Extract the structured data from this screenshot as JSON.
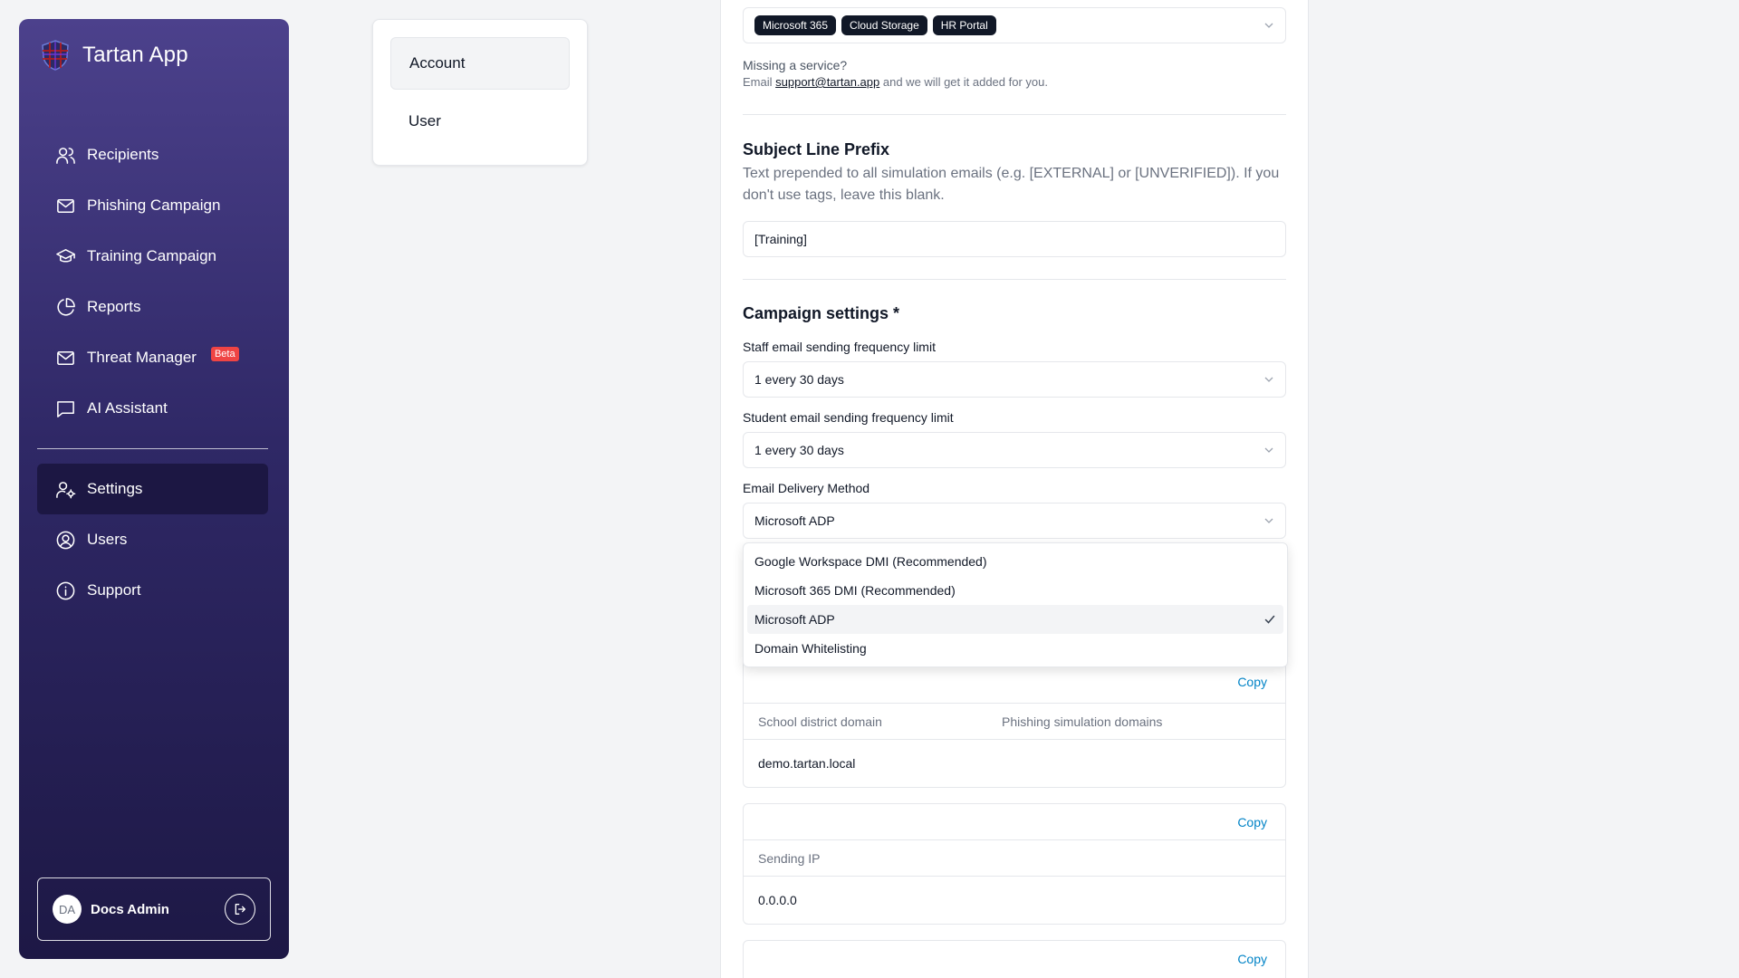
{
  "app": {
    "name": "Tartan App"
  },
  "sidebar": {
    "items": [
      {
        "label": "Recipients",
        "icon": "users-icon"
      },
      {
        "label": "Phishing Campaign",
        "icon": "mail-icon"
      },
      {
        "label": "Training Campaign",
        "icon": "graduation-cap-icon"
      },
      {
        "label": "Reports",
        "icon": "pie-chart-icon"
      },
      {
        "label": "Threat Manager",
        "icon": "mail-icon",
        "badge": "Beta"
      },
      {
        "label": "AI Assistant",
        "icon": "message-square-icon"
      }
    ],
    "secondary": [
      {
        "label": "Settings",
        "icon": "user-cog-icon",
        "active": true
      },
      {
        "label": "Users",
        "icon": "user-circle-icon"
      },
      {
        "label": "Support",
        "icon": "info-icon"
      }
    ],
    "user": {
      "initials": "DA",
      "name": "Docs Admin"
    }
  },
  "settings_menu": {
    "items": [
      "Account",
      "User"
    ]
  },
  "services": {
    "tags": [
      "Microsoft 365",
      "Cloud Storage",
      "HR Portal"
    ],
    "missing_title": "Missing a service?",
    "missing_prefix": "Email",
    "missing_email": "support@tartan.app",
    "missing_suffix": "and we will get it added for you."
  },
  "subject_prefix": {
    "title": "Subject Line Prefix",
    "description": "Text prepended to all simulation emails (e.g. [EXTERNAL] or [UNVERIFIED]). If you don't use tags, leave this blank.",
    "value": "[Training]"
  },
  "campaign": {
    "title": "Campaign settings *",
    "staff_label": "Staff email sending frequency limit",
    "staff_value": "1 every 30 days",
    "student_label": "Student email sending frequency limit",
    "student_value": "1 every 30 days",
    "delivery_label": "Email Delivery Method",
    "delivery_value": "Microsoft ADP",
    "delivery_options": [
      "Google Workspace DMI (Recommended)",
      "Microsoft 365 DMI (Recommended)",
      "Microsoft ADP",
      "Domain Whitelisting"
    ]
  },
  "cards": {
    "copy_label": "Copy",
    "domains": {
      "col1": "School district domain",
      "col2": "Phishing simulation domains",
      "value": "demo.tartan.local"
    },
    "ip": {
      "header": "Sending IP",
      "value": "0.0.0.0"
    }
  },
  "colors": {
    "accent": "#0284c7",
    "sidebar_top": "#4c418c",
    "sidebar_bottom": "#1d1845",
    "beta": "#ef4444"
  }
}
